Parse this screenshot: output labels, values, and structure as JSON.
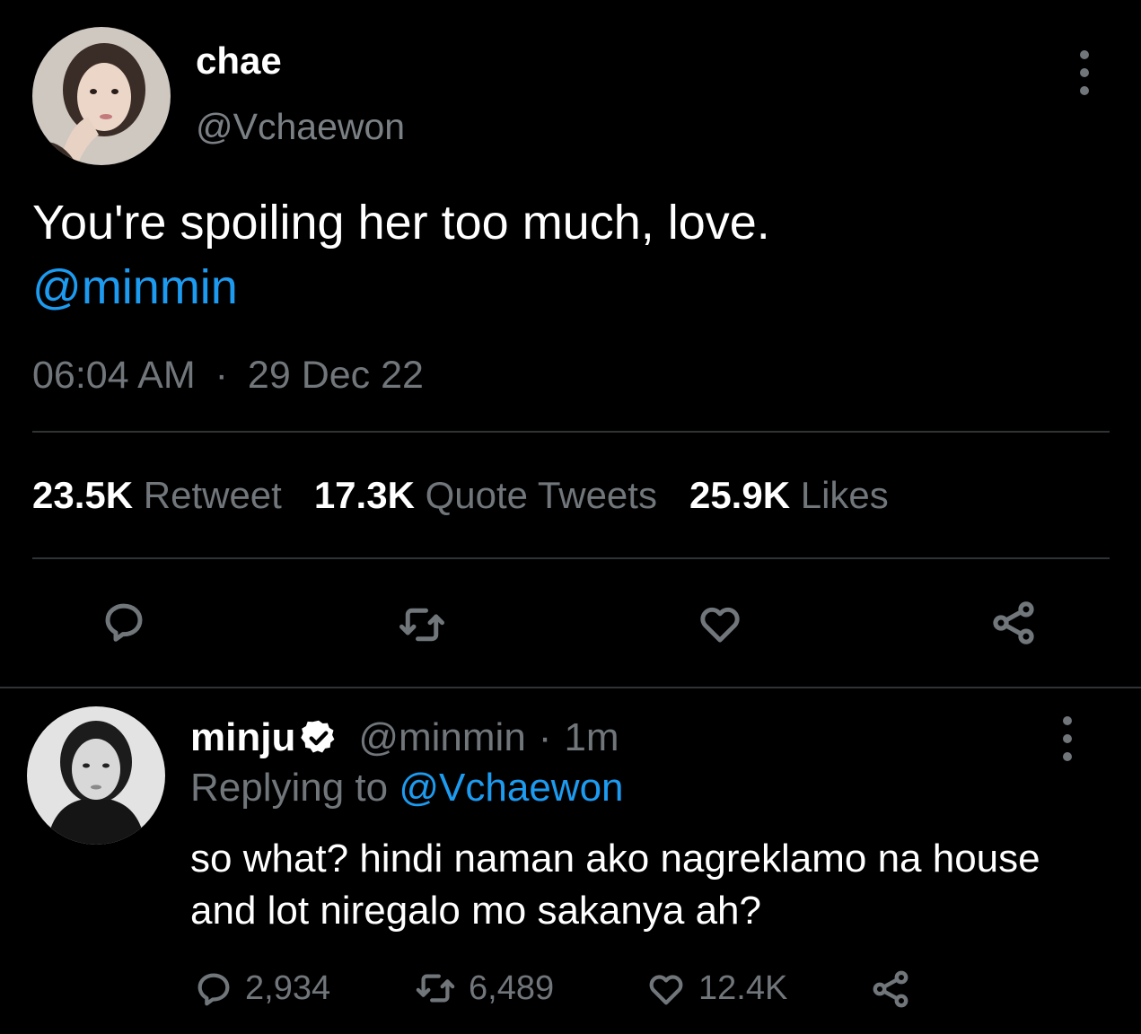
{
  "tweet": {
    "display_name": "chae",
    "handle": "@Vchaewon",
    "text": "You're spoiling her too much, love.",
    "mention": "@minmin",
    "time": "06:04 AM",
    "separator": "·",
    "date": "29 Dec 22",
    "stats": {
      "retweets_count": "23.5K",
      "retweets_label": "Retweet",
      "quotes_count": "17.3K",
      "quotes_label": "Quote Tweets",
      "likes_count": "25.9K",
      "likes_label": "Likes"
    },
    "actions": [
      "reply-icon",
      "retweet-icon",
      "like-icon",
      "share-icon"
    ]
  },
  "reply": {
    "display_name": "minju",
    "handle": "@minmin",
    "separator": "·",
    "age": "1m",
    "replying_prefix": "Replying to",
    "replying_to": "@Vchaewon",
    "text": "so what? hindi naman ako nagreklamo na house and lot niregalo mo sakanya ah?",
    "replies": "2,934",
    "retweets": "6,489",
    "likes": "12.4K"
  },
  "colors": {
    "background": "#000000",
    "text": "#ffffff",
    "muted": "#71767b",
    "accent": "#1d9bf0",
    "divider": "#2f3336"
  }
}
